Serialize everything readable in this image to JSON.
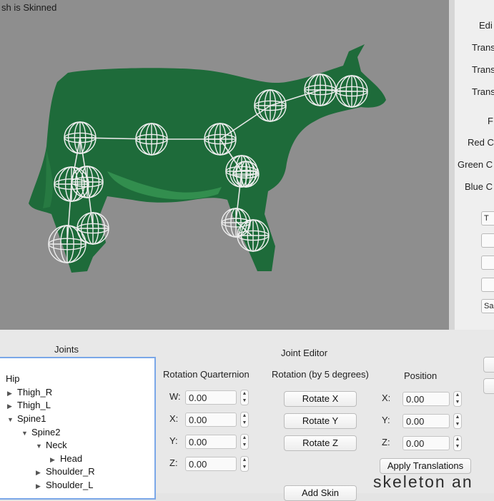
{
  "viewport": {
    "status": "sh is Skinned"
  },
  "right_panel": {
    "labels": [
      "Edi",
      "Trans",
      "Trans",
      "Trans",
      "F",
      "Red C",
      "Green C",
      "Blue C"
    ],
    "boxes": [
      "T",
      "",
      "",
      "",
      "",
      "Sa",
      "",
      ""
    ]
  },
  "joints_panel": {
    "title": "Joints",
    "tree": [
      {
        "label": "Hip",
        "arrow": ""
      },
      {
        "label": "Thigh_R",
        "arrow": "▶"
      },
      {
        "label": "Thigh_L",
        "arrow": "▶"
      },
      {
        "label": "Spine1",
        "arrow": "▼"
      },
      {
        "label": "Spine2",
        "arrow": "▼"
      },
      {
        "label": "Neck",
        "arrow": "▼"
      },
      {
        "label": "Head",
        "arrow": "▶"
      },
      {
        "label": "Shoulder_R",
        "arrow": "▶"
      },
      {
        "label": "Shoulder_L",
        "arrow": "▶"
      }
    ]
  },
  "joint_editor": {
    "title": "Joint Editor",
    "rotation_quaternion": {
      "header": "Rotation Quarternion",
      "fields": [
        {
          "label": "W:",
          "value": "0.00"
        },
        {
          "label": "X:",
          "value": "0.00"
        },
        {
          "label": "Y:",
          "value": "0.00"
        },
        {
          "label": "Z:",
          "value": "0.00"
        }
      ]
    },
    "rotation_step": {
      "header": "Rotation (by 5 degrees)",
      "buttons": [
        "Rotate X",
        "Rotate Y",
        "Rotate Z"
      ]
    },
    "position": {
      "header": "Position",
      "fields": [
        {
          "label": "X:",
          "value": "0.00"
        },
        {
          "label": "Y:",
          "value": "0.00"
        },
        {
          "label": "Z:",
          "value": "0.00"
        }
      ],
      "apply_button": "Apply Translations"
    },
    "add_skin_button": "Add Skin"
  },
  "watermark": "skeleton an",
  "colors": {
    "cow": "#1e6b3a",
    "cow_highlight": "#3fa55c",
    "viewport_bg": "#8e8e8e",
    "focus_ring": "#7aa7e8"
  }
}
